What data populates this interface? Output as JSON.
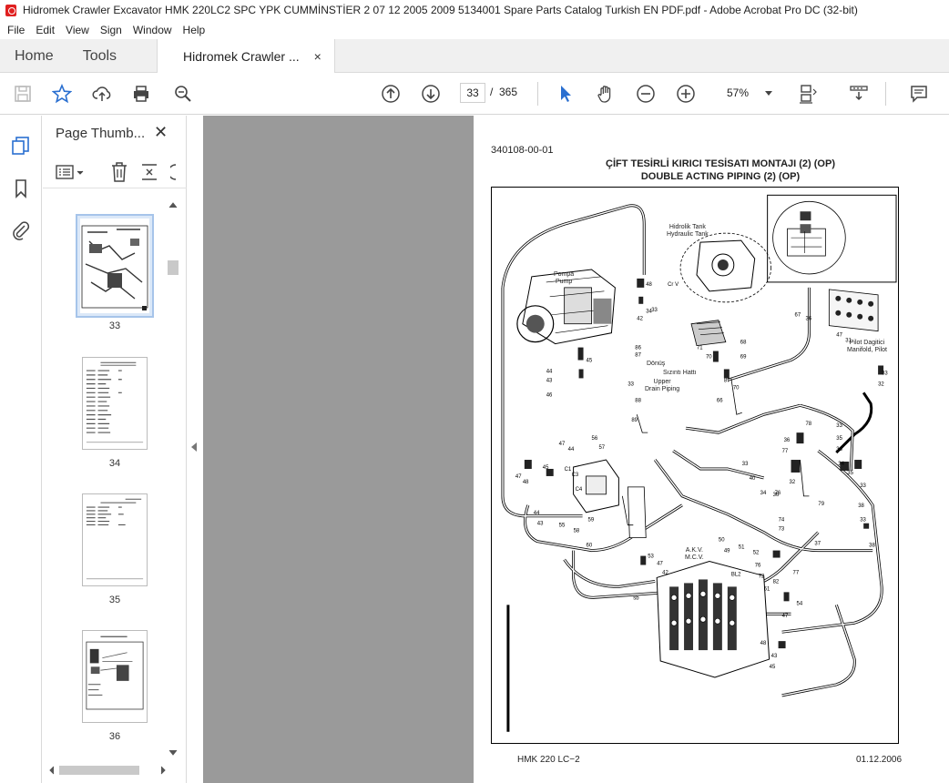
{
  "window": {
    "title": "Hidromek Crawler Excavator HMK 220LC2 SPC YPK CUMMİNSTİER 2 07 12 2005 2009 5134001 Spare Parts Catalog Turkish EN PDF.pdf - Adobe Acrobat Pro DC (32-bit)"
  },
  "menu": [
    "File",
    "Edit",
    "View",
    "Sign",
    "Window",
    "Help"
  ],
  "tabs": {
    "home": "Home",
    "tools": "Tools",
    "document": "Hidromek Crawler ...",
    "close": "×"
  },
  "toolbar": {
    "current_page": "33",
    "page_separator": "/",
    "total_pages": "365",
    "zoom": "57%"
  },
  "panel": {
    "title": "Page Thumb...",
    "close": "✕"
  },
  "thumbnails": [
    {
      "label": "33"
    },
    {
      "label": "34"
    },
    {
      "label": "35"
    },
    {
      "label": "36"
    }
  ],
  "document": {
    "code": "340108-00-01",
    "title_tr": "ÇİFT TESİRLİ KIRICI TESİSATI MONTAJI (2) (OP)",
    "title_en": "DOUBLE ACTING PIPING (2) (OP)",
    "footer_model": "HMK  220  LC−2",
    "footer_date": "01.12.2006",
    "labels": {
      "pompa": "Pompa",
      "pump": "Pump",
      "hidrolik_tank": "Hidrolik Tank",
      "hydraulic_tank": "Hydraulic Tank",
      "pilot_dagitici": "Pilot Dagitici",
      "manifold_pilot": "Manifold, Pilot",
      "donus": "Dönüş",
      "sizinti_hatti": "Sızıntı Hattı",
      "upper": "Upper",
      "drain_piping": "Drain Piping",
      "akv": "A.K.V.",
      "mcv": "M.C.V."
    }
  }
}
